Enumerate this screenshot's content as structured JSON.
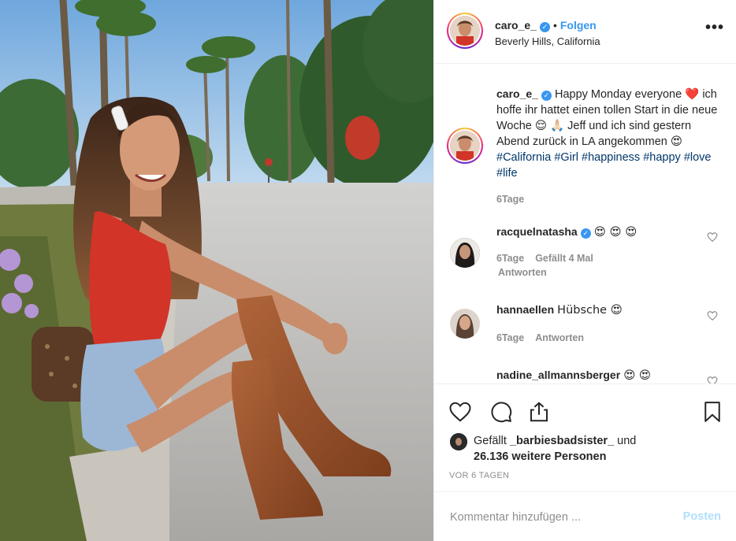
{
  "header": {
    "username": "caro_e_",
    "verified_mark": "✓",
    "separator": "•",
    "follow_label": "Folgen",
    "location": "Beverly Hills, California",
    "more_label": "•••"
  },
  "caption": {
    "username": "caro_e_",
    "text_1": "Happy Monday everyone",
    "emoji_heart": "❤️",
    "text_2": "ich hoffe ihr hattet einen tollen Start in die neue Woche",
    "emoji_relieved": "😌",
    "emoji_pray": "🙏🏻",
    "text_3": "Jeff und ich sind gestern Abend zurück in LA angekommen",
    "emoji_hearteyes": "😍",
    "hashtags": [
      "#California",
      "#Girl",
      "#happiness",
      "#happy",
      "#love",
      "#life"
    ],
    "time": "6Tage"
  },
  "comments": [
    {
      "username": "racquelnatasha",
      "verified": true,
      "text": "😍 😍 😍",
      "time": "6Tage",
      "likes": "Gefällt 4 Mal",
      "reply": "Antworten"
    },
    {
      "username": "hannaellen",
      "verified": false,
      "text": "Hübsche 😍",
      "time": "6Tage",
      "reply": "Antworten"
    },
    {
      "username": "nadine_allmannsberger",
      "verified": false,
      "text": "😍 😍"
    }
  ],
  "actions": {
    "like_icon": "heart-icon",
    "comment_icon": "comment-icon",
    "share_icon": "share-icon",
    "save_icon": "bookmark-icon"
  },
  "likes": {
    "prefix": "Gefällt",
    "user": "_barbiesbadsister_",
    "middle": "und",
    "count": "26.136 weitere Personen"
  },
  "date": "VOR 6 TAGEN",
  "add_comment": {
    "placeholder": "Kommentar hinzufügen ...",
    "post_label": "Posten"
  },
  "colors": {
    "accent_blue": "#3897f0",
    "hashtag": "#00376b",
    "muted": "#8e8e8e",
    "post_disabled": "#b2dffc"
  }
}
